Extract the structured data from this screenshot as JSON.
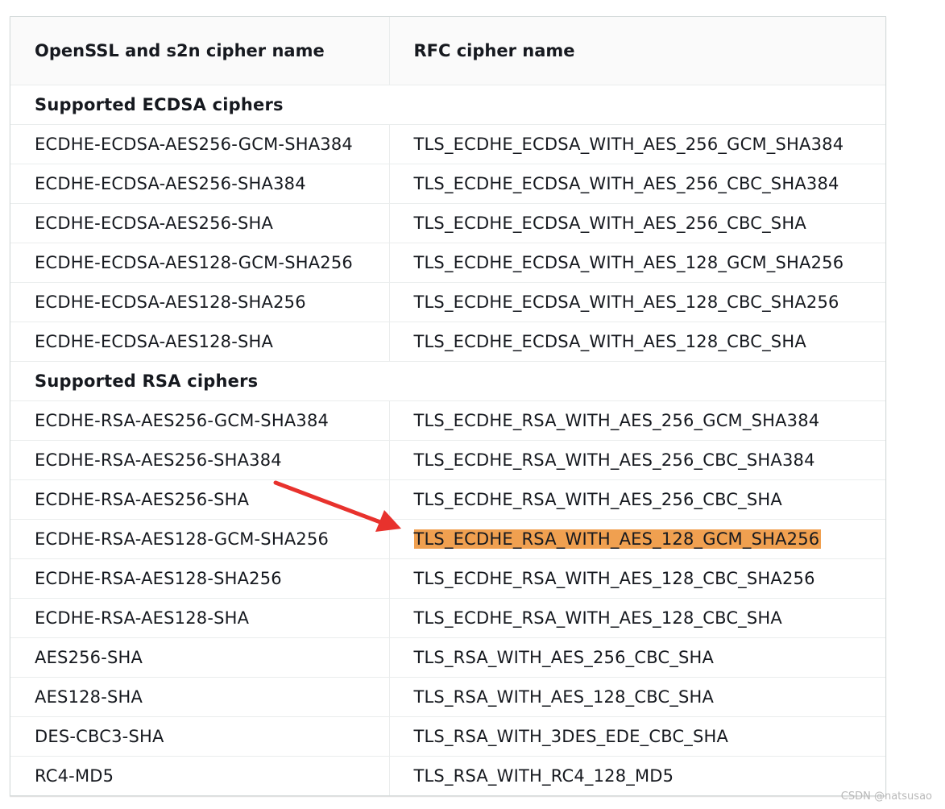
{
  "table": {
    "headers": [
      "OpenSSL and s2n cipher name",
      "RFC cipher name"
    ],
    "rows": [
      {
        "type": "section",
        "label": "Supported ECDSA ciphers"
      },
      {
        "type": "row",
        "openssl": "ECDHE-ECDSA-AES256-GCM-SHA384",
        "rfc": "TLS_ECDHE_ECDSA_WITH_AES_256_GCM_SHA384"
      },
      {
        "type": "row",
        "openssl": "ECDHE-ECDSA-AES256-SHA384",
        "rfc": "TLS_ECDHE_ECDSA_WITH_AES_256_CBC_SHA384"
      },
      {
        "type": "row",
        "openssl": "ECDHE-ECDSA-AES256-SHA",
        "rfc": "TLS_ECDHE_ECDSA_WITH_AES_256_CBC_SHA"
      },
      {
        "type": "row",
        "openssl": "ECDHE-ECDSA-AES128-GCM-SHA256",
        "rfc": "TLS_ECDHE_ECDSA_WITH_AES_128_GCM_SHA256"
      },
      {
        "type": "row",
        "openssl": "ECDHE-ECDSA-AES128-SHA256",
        "rfc": "TLS_ECDHE_ECDSA_WITH_AES_128_CBC_SHA256"
      },
      {
        "type": "row",
        "openssl": "ECDHE-ECDSA-AES128-SHA",
        "rfc": "TLS_ECDHE_ECDSA_WITH_AES_128_CBC_SHA"
      },
      {
        "type": "section",
        "label": "Supported RSA ciphers"
      },
      {
        "type": "row",
        "openssl": "ECDHE-RSA-AES256-GCM-SHA384",
        "rfc": "TLS_ECDHE_RSA_WITH_AES_256_GCM_SHA384"
      },
      {
        "type": "row",
        "openssl": "ECDHE-RSA-AES256-SHA384",
        "rfc": "TLS_ECDHE_RSA_WITH_AES_256_CBC_SHA384"
      },
      {
        "type": "row",
        "openssl": "ECDHE-RSA-AES256-SHA",
        "rfc": "TLS_ECDHE_RSA_WITH_AES_256_CBC_SHA"
      },
      {
        "type": "row",
        "openssl": "ECDHE-RSA-AES128-GCM-SHA256",
        "rfc": "TLS_ECDHE_RSA_WITH_AES_128_GCM_SHA256",
        "highlighted": true
      },
      {
        "type": "row",
        "openssl": "ECDHE-RSA-AES128-SHA256",
        "rfc": "TLS_ECDHE_RSA_WITH_AES_128_CBC_SHA256"
      },
      {
        "type": "row",
        "openssl": "ECDHE-RSA-AES128-SHA",
        "rfc": "TLS_ECDHE_RSA_WITH_AES_128_CBC_SHA"
      },
      {
        "type": "row",
        "openssl": "AES256-SHA",
        "rfc": "TLS_RSA_WITH_AES_256_CBC_SHA"
      },
      {
        "type": "row",
        "openssl": "AES128-SHA",
        "rfc": "TLS_RSA_WITH_AES_128_CBC_SHA"
      },
      {
        "type": "row",
        "openssl": "DES-CBC3-SHA",
        "rfc": "TLS_RSA_WITH_3DES_EDE_CBC_SHA"
      },
      {
        "type": "row",
        "openssl": "RC4-MD5",
        "rfc": "TLS_RSA_WITH_RC4_128_MD5"
      }
    ]
  },
  "annotation": {
    "arrow_icon": "red-arrow-icon",
    "arrow_color": "#e8322d",
    "highlight_color": "#f0a050"
  },
  "watermark": "CSDN @natsusao"
}
